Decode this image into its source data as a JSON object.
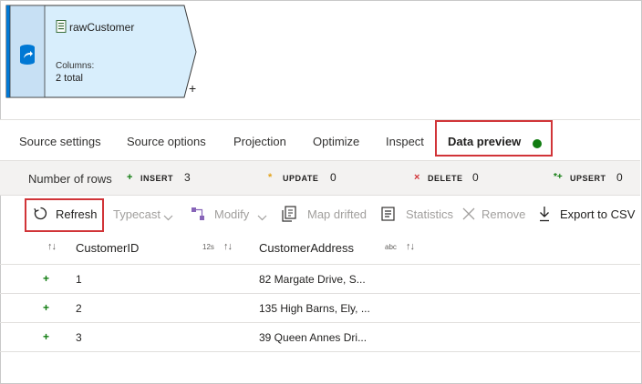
{
  "node": {
    "title": "rawCustomer",
    "columns_label": "Columns:",
    "columns_value": "2 total",
    "add_symbol": "+",
    "fill_color": "#d8eefc",
    "accent_color": "#0078d4"
  },
  "tabs": [
    {
      "label": "Source settings"
    },
    {
      "label": "Source options"
    },
    {
      "label": "Projection"
    },
    {
      "label": "Optimize"
    },
    {
      "label": "Inspect"
    },
    {
      "label": "Data preview",
      "active": true,
      "status": "green-dot"
    }
  ],
  "stats": {
    "label": "Number of rows",
    "insert": {
      "symbol": "+",
      "key": "INSERT",
      "value": "3",
      "color": "#107c10"
    },
    "update": {
      "symbol": "*",
      "key": "UPDATE",
      "value": "0",
      "color": "#e3a21a"
    },
    "delete": {
      "symbol": "×",
      "key": "DELETE",
      "value": "0",
      "color": "#d13438"
    },
    "upsert": {
      "symbol": "*+",
      "key": "UPSERT",
      "value": "0",
      "color": "#107c10"
    }
  },
  "toolbar": {
    "refresh": "Refresh",
    "typecast": "Typecast",
    "modify": "Modify",
    "map_drifted": "Map drifted",
    "statistics": "Statistics",
    "remove": "Remove",
    "export": "Export to CSV"
  },
  "grid": {
    "columns": [
      {
        "name": "CustomerID",
        "type_tag": "12s"
      },
      {
        "name": "CustomerAddress",
        "type_tag": "abc"
      }
    ],
    "sort_symbol": "↑↓",
    "rows": [
      {
        "marker": "+",
        "id": "1",
        "address": "82 Margate Drive, S..."
      },
      {
        "marker": "+",
        "id": "2",
        "address": "135 High Barns, Ely, ..."
      },
      {
        "marker": "+",
        "id": "3",
        "address": "39 Queen Annes Dri..."
      }
    ]
  }
}
